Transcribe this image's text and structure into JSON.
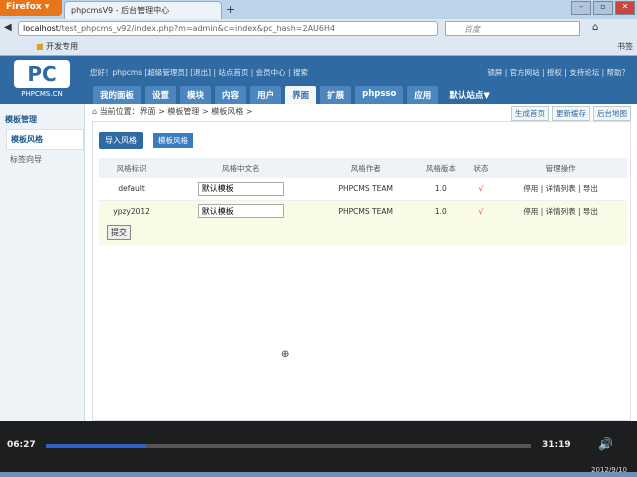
{
  "browser": {
    "firefox_label": "Firefox ▾",
    "tab_title": "phpcmsV9 - 后台管理中心",
    "new_tab": "+",
    "url_host": "localhost",
    "url_path": "/test_phpcms_v92/index.php?m=admin&c=index&pc_hash=2AU6H4",
    "search_placeholder": "百度",
    "bookmark_folder": "开发专用",
    "bookmarks_label": "书签"
  },
  "header": {
    "logo_text": "PC",
    "logo_sub": "PHPCMS.CN",
    "top_links": "您好！phpcms [超级管理员]  [退出] | 站点首页 | 会员中心 | 搜索",
    "right_links": "锁屏 | 官方网站 | 授权 | 支持论坛 | 帮助？",
    "menu": [
      "我的面板",
      "设置",
      "模块",
      "内容",
      "用户",
      "界面",
      "扩展",
      "phpsso",
      "应用"
    ],
    "site_menu": "默认站点▼"
  },
  "sidebar": {
    "title": "模板管理",
    "items": [
      "模板风格",
      "标签向导"
    ]
  },
  "breadcrumb": "当前位置：界面 > 模板管理 > 模板风格 >",
  "right_buttons": [
    "生成首页",
    "更新缓存",
    "后台地图"
  ],
  "buttons": {
    "import": "导入风格",
    "styles": "模板风格",
    "submit": "提交"
  },
  "table": {
    "headers": [
      "风格标识",
      "风格中文名",
      "风格作者",
      "风格版本",
      "状态",
      "管理操作"
    ],
    "rows": [
      {
        "id": "default",
        "name": "默认模板",
        "author": "PHPCMS TEAM",
        "version": "1.0",
        "status": "√",
        "actions": "停用 | 详情列表 | 导出"
      },
      {
        "id": "ypzy2012",
        "name": "默认模板",
        "author": "PHPCMS TEAM",
        "version": "1.0",
        "status": "√",
        "actions": "停用 | 详情列表 | 导出"
      }
    ]
  },
  "player": {
    "current": "06:27",
    "total": "31:19",
    "progress": 0.206
  },
  "taskbar": {
    "date": "2012/9/10"
  }
}
